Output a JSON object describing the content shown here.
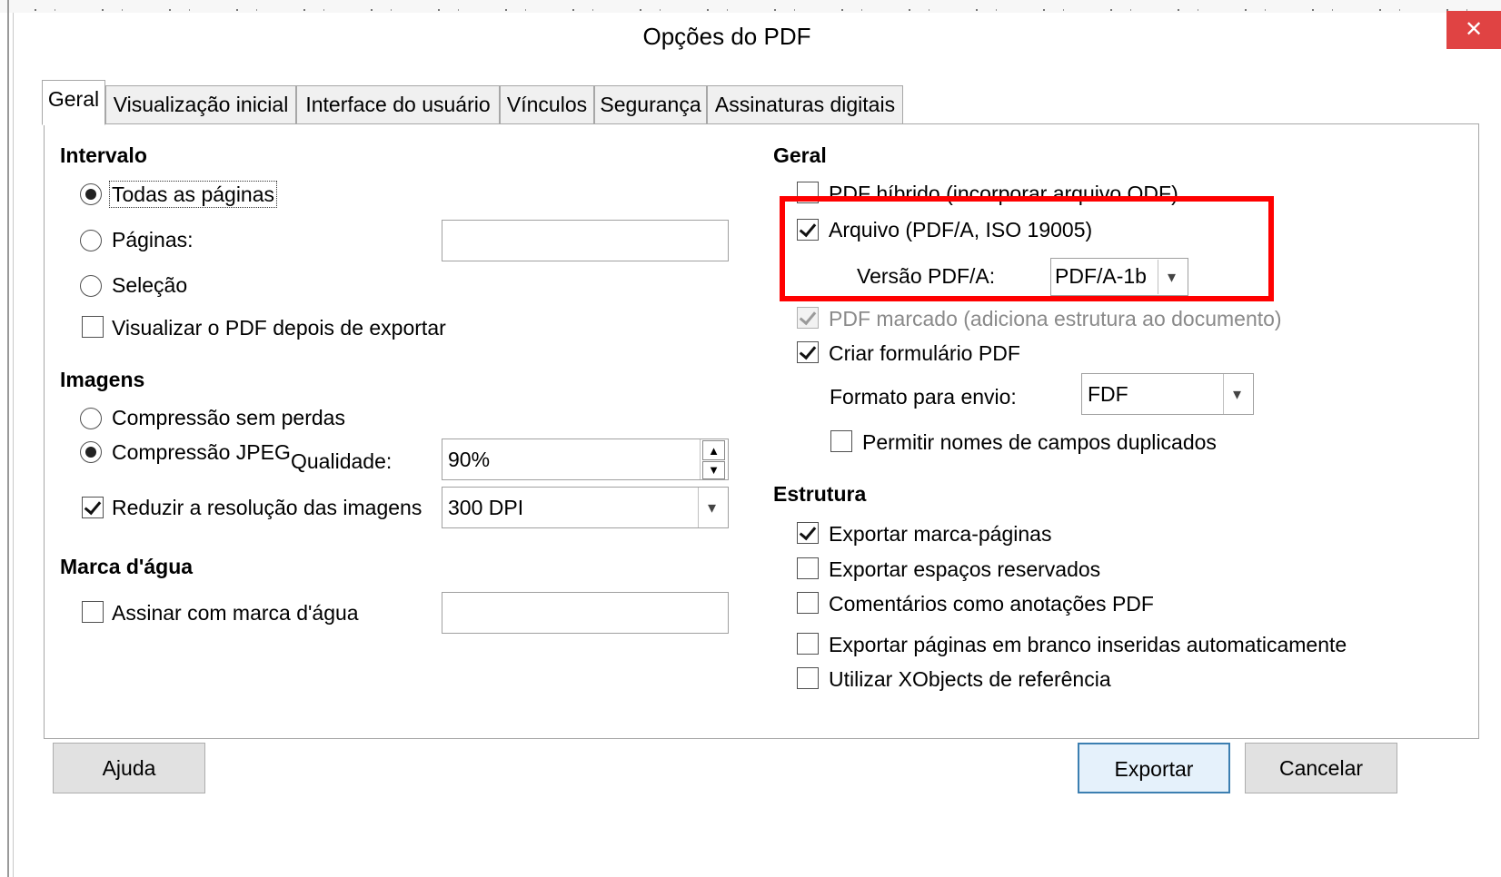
{
  "dialog": {
    "title": "Opções do PDF",
    "close_icon": "close-icon",
    "tabs": [
      {
        "label": "Geral",
        "active": true
      },
      {
        "label": "Visualização inicial"
      },
      {
        "label": "Interface do usuário"
      },
      {
        "label": "Vínculos"
      },
      {
        "label": "Segurança"
      },
      {
        "label": "Assinaturas digitais"
      }
    ]
  },
  "left": {
    "range": {
      "heading": "Intervalo",
      "all_pages": "Todas as páginas",
      "pages": "Páginas:",
      "pages_value": "",
      "selection": "Seleção",
      "view_after": "Visualizar o PDF depois de exportar"
    },
    "images": {
      "heading": "Imagens",
      "lossless": "Compressão sem perdas",
      "jpeg": "Compressão JPEG",
      "quality_label": "Qualidade:",
      "quality_value": "90%",
      "reduce": "Reduzir a resolução das imagens",
      "resolution_value": "300 DPI"
    },
    "watermark": {
      "heading": "Marca d'água",
      "sign": "Assinar com marca d'água",
      "value": ""
    }
  },
  "right": {
    "general": {
      "heading": "Geral",
      "hybrid": "PDF híbrido (incorporar arquivo ODF)",
      "archive": "Arquivo (PDF/A, ISO 19005)",
      "version_label": "Versão PDF/A:",
      "version_value": "PDF/A-1b",
      "tagged": "PDF marcado (adiciona estrutura ao documento)",
      "create_form": "Criar formulário PDF",
      "format_label": "Formato para envio:",
      "format_value": "FDF",
      "duplicate_names": "Permitir nomes de campos duplicados"
    },
    "structure": {
      "heading": "Estrutura",
      "bookmarks": "Exportar marca-páginas",
      "placeholders": "Exportar espaços reservados",
      "comments": "Comentários como anotações PDF",
      "blank_pages": "Exportar páginas em branco inseridas automaticamente",
      "xobjects": "Utilizar XObjects de referência"
    }
  },
  "buttons": {
    "help": "Ajuda",
    "export": "Exportar",
    "cancel": "Cancelar"
  },
  "colors": {
    "highlight": "#ff0000",
    "close": "#e04343",
    "default_button_border": "#3c7fb1"
  }
}
